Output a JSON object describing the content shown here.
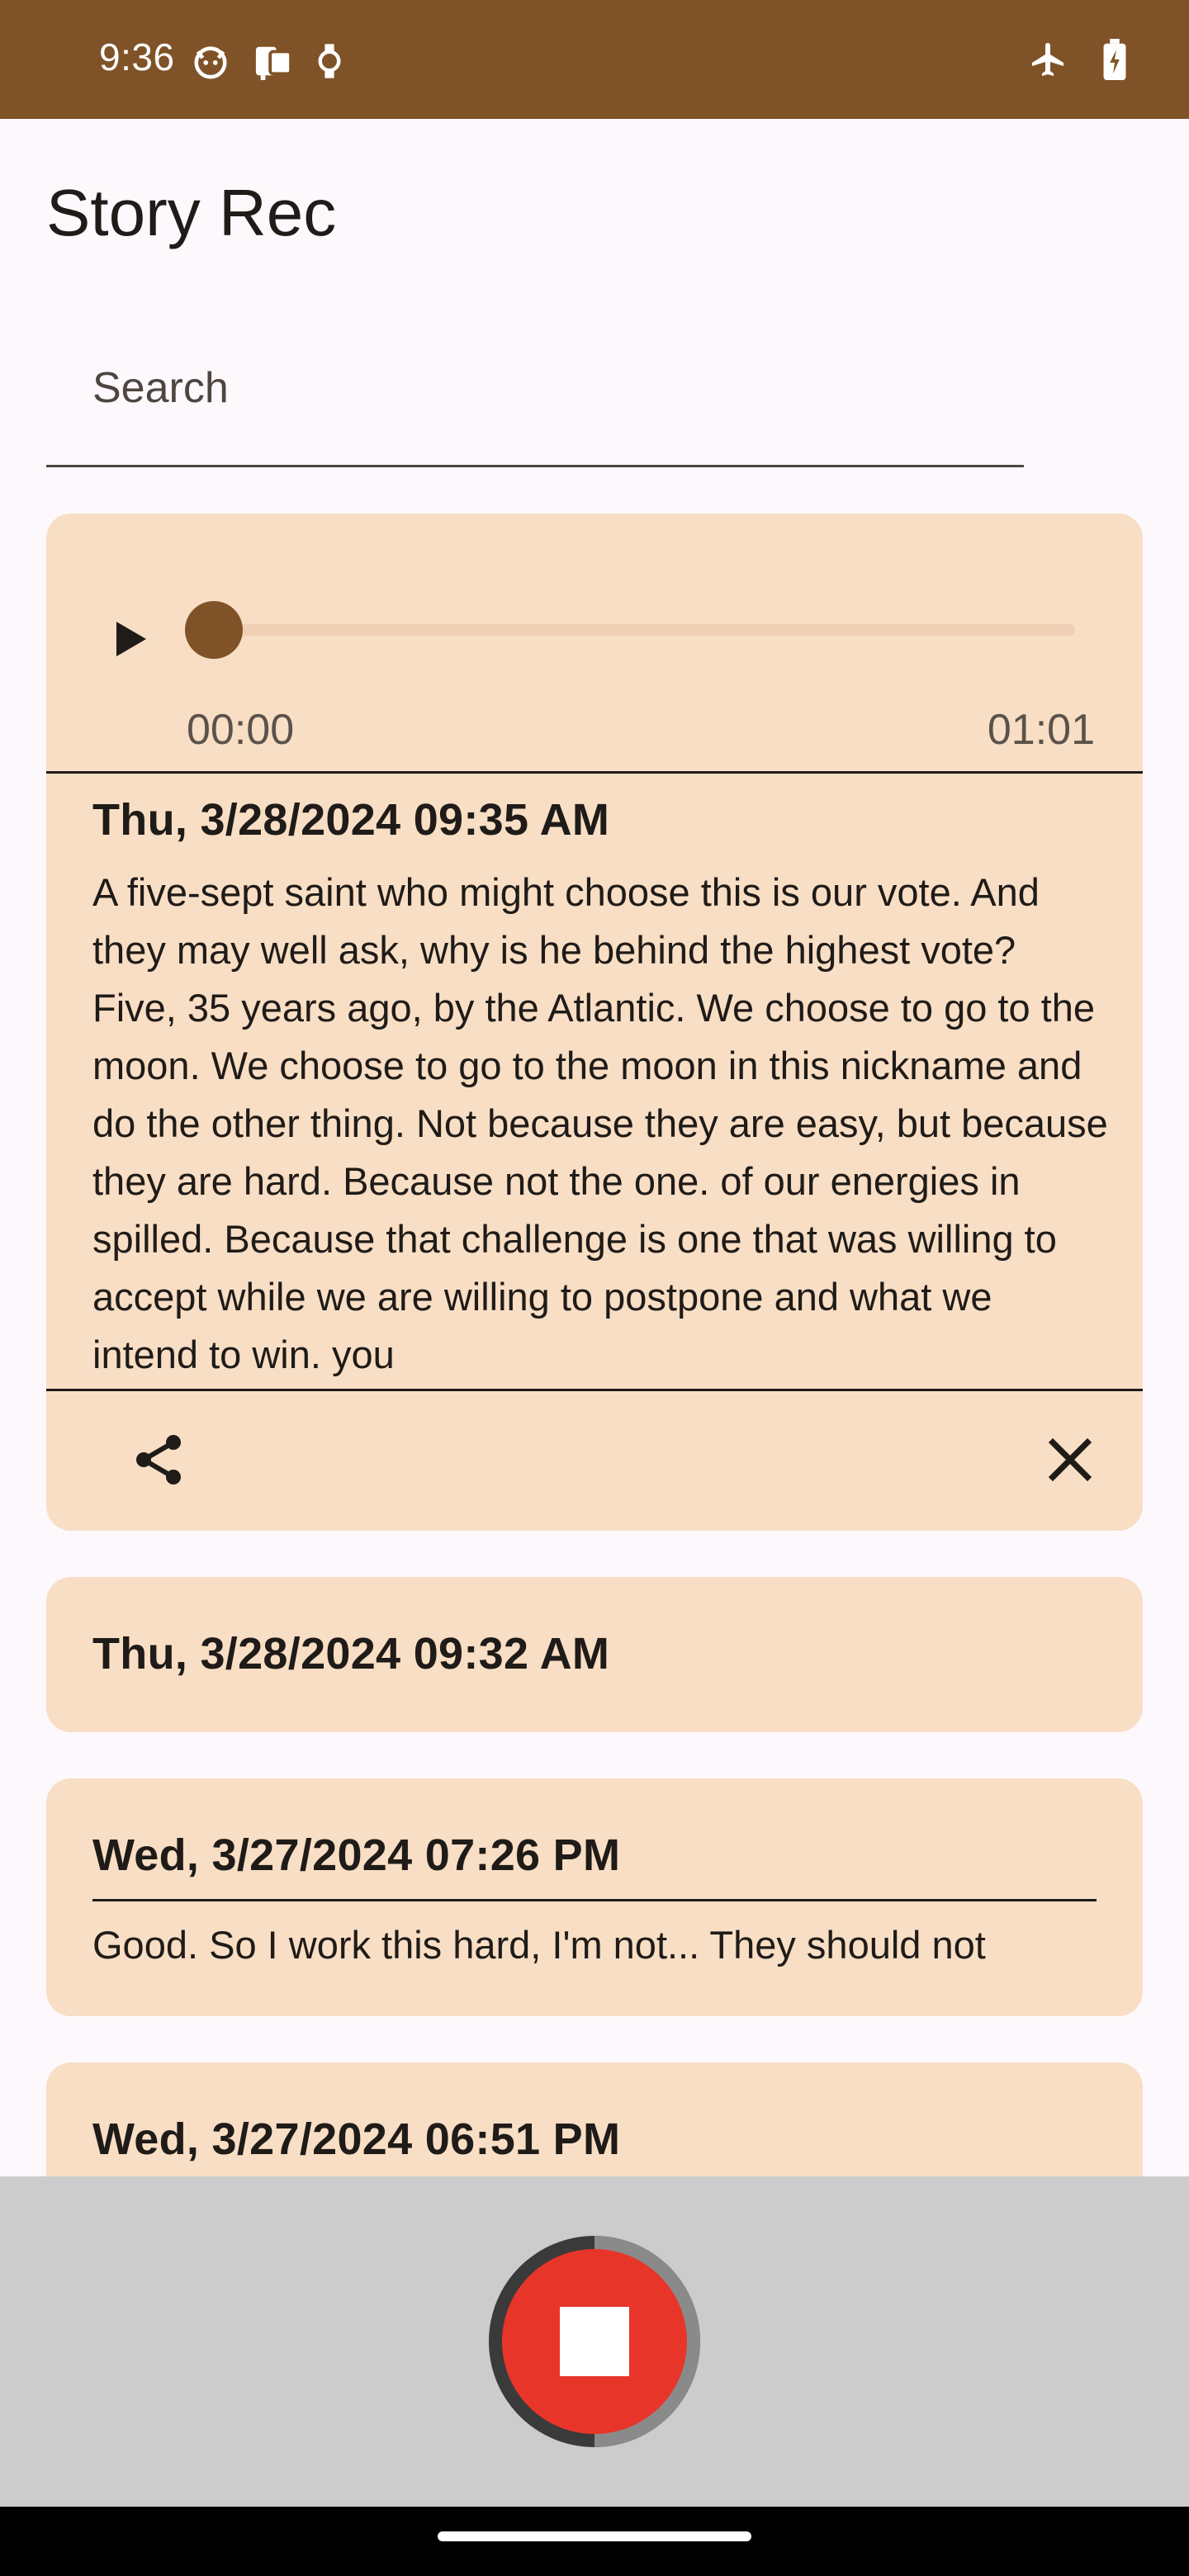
{
  "status_bar": {
    "time": "9:36",
    "icons_left": [
      "cat-face-icon",
      "devices-icon",
      "watch-icon"
    ],
    "icons_right": [
      "airplane-mode-icon",
      "battery-charging-icon"
    ],
    "background": "#7f5327"
  },
  "app": {
    "title": "Story Rec"
  },
  "search": {
    "placeholder": "Search",
    "value": ""
  },
  "player": {
    "current_time": "00:00",
    "total_time": "01:01",
    "progress": 0
  },
  "recordings": [
    {
      "title": "Thu, 3/28/2024 09:35 AM",
      "expanded": true,
      "transcript": "A five-sept saint who might choose this is our vote. And they may well ask, why is he behind the highest vote? Five, 35 years ago, by the Atlantic. We choose to go to the moon. We choose to go to the moon in this nickname and do the other thing. Not because they are easy, but because they are hard. Because not the one. of our energies in spilled. Because that challenge is one that was willing to accept while we are willing to postpone and what we intend to win. you"
    },
    {
      "title": "Thu, 3/28/2024 09:32 AM",
      "expanded": false
    },
    {
      "title": "Wed, 3/27/2024 07:26 PM",
      "expanded": false,
      "snippet": "Good. So I work this hard, I'm not... They should not"
    },
    {
      "title": "Wed, 3/27/2024 06:51 PM",
      "expanded": false
    }
  ],
  "colors": {
    "accent": "#7f5327",
    "card": "#f8dec4",
    "record": "#e8352a",
    "bottom_panel": "#cccccc"
  }
}
